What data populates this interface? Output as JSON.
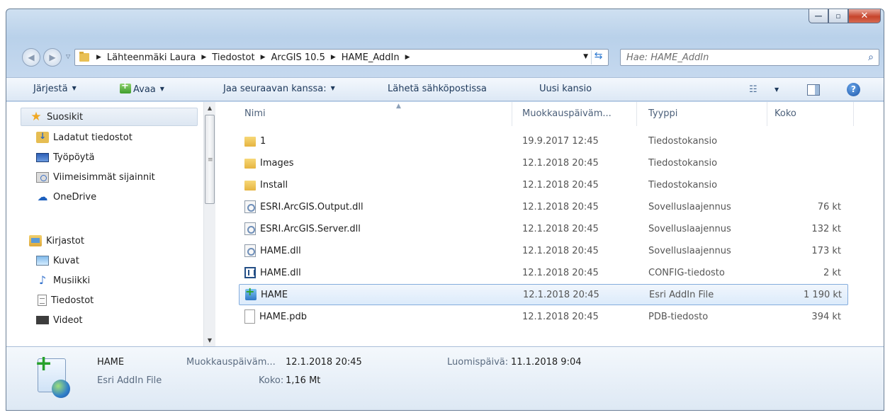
{
  "window": {
    "controls": {
      "minimize": "—",
      "maximize": "▫",
      "close": "✕"
    }
  },
  "address": {
    "crumbs": [
      "Lähteenmäki Laura",
      "Tiedostot",
      "ArcGIS 10.5",
      "HAME_AddIn"
    ],
    "search_placeholder": "Hae: HAME_AddIn"
  },
  "toolbar": {
    "organize": "Järjestä",
    "open": "Avaa",
    "share": "Jaa seuraavan kanssa:",
    "email": "Lähetä sähköpostissa",
    "new_folder": "Uusi kansio"
  },
  "nav": {
    "favorites": "Suosikit",
    "favorites_items": [
      "Ladatut tiedostot",
      "Työpöytä",
      "Viimeisimmät sijainnit",
      "OneDrive"
    ],
    "libraries": "Kirjastot",
    "library_items": [
      "Kuvat",
      "Musiikki",
      "Tiedostot",
      "Videot"
    ]
  },
  "columns": {
    "name": "Nimi",
    "modified": "Muokkauspäiväm...",
    "type": "Tyyppi",
    "size": "Koko"
  },
  "files": [
    {
      "name": "1",
      "date": "19.9.2017 12:45",
      "type": "Tiedostokansio",
      "size": "",
      "icon": "folder-icon"
    },
    {
      "name": "Images",
      "date": "12.1.2018 20:45",
      "type": "Tiedostokansio",
      "size": "",
      "icon": "folder-icon"
    },
    {
      "name": "Install",
      "date": "12.1.2018 20:45",
      "type": "Tiedostokansio",
      "size": "",
      "icon": "folder-icon"
    },
    {
      "name": "ESRI.ArcGIS.Output.dll",
      "date": "12.1.2018 20:45",
      "type": "Sovelluslaajennus",
      "size": "76 kt",
      "icon": "dll-icon"
    },
    {
      "name": "ESRI.ArcGIS.Server.dll",
      "date": "12.1.2018 20:45",
      "type": "Sovelluslaajennus",
      "size": "132 kt",
      "icon": "dll-icon"
    },
    {
      "name": "HAME.dll",
      "date": "12.1.2018 20:45",
      "type": "Sovelluslaajennus",
      "size": "173 kt",
      "icon": "dll-icon"
    },
    {
      "name": "HAME.dll",
      "date": "12.1.2018 20:45",
      "type": "CONFIG-tiedosto",
      "size": "2 kt",
      "icon": "config-icon"
    },
    {
      "name": "HAME",
      "date": "12.1.2018 20:45",
      "type": "Esri AddIn File",
      "size": "1 190 kt",
      "icon": "esri-addin-icon"
    },
    {
      "name": "HAME.pdb",
      "date": "12.1.2018 20:45",
      "type": "PDB-tiedosto",
      "size": "394 kt",
      "icon": "pdb-icon"
    }
  ],
  "selected_file": "HAME",
  "details": {
    "name": "HAME",
    "type": "Esri AddIn File",
    "modified_label": "Muokkauspäiväm...",
    "modified_value": "12.1.2018 20:45",
    "size_label": "Koko:",
    "size_value": "1,16 Mt",
    "created_label": "Luomispäivä:",
    "created_value": "11.1.2018 9:04"
  },
  "colors": {
    "chrome": "#c6d9ef",
    "selection": "#dcebfb",
    "selection_border": "#84acdd",
    "close_button": "#c7442b"
  }
}
